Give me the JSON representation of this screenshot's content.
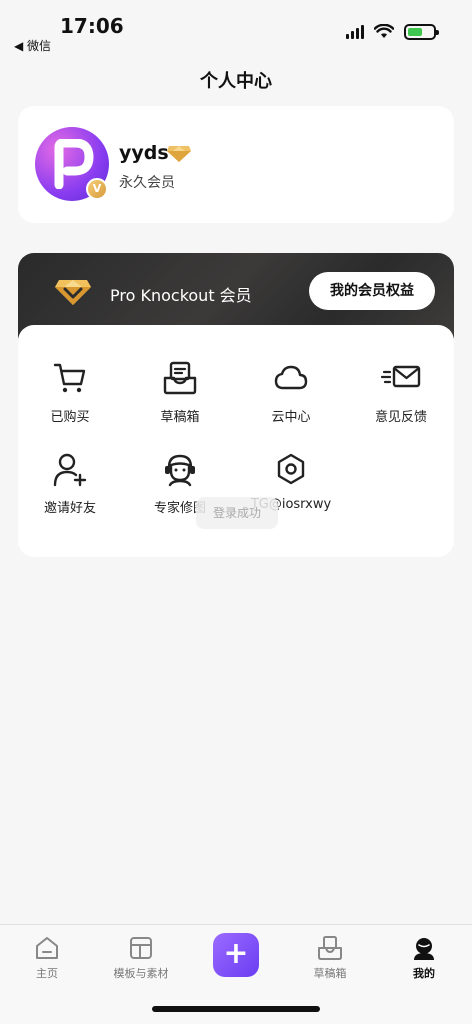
{
  "status_bar": {
    "time": "17:06",
    "back_app": "◀ 微信"
  },
  "page_title": "个人中心",
  "profile": {
    "username": "yyds",
    "member_type": "永久会员",
    "badge": "V"
  },
  "pro_banner": {
    "title": "Pro Knockout 会员",
    "button_label": "我的会员权益"
  },
  "grid": {
    "items": [
      {
        "label": "已购买",
        "icon": "cart-icon"
      },
      {
        "label": "草稿箱",
        "icon": "drafts-icon"
      },
      {
        "label": "云中心",
        "icon": "cloud-icon"
      },
      {
        "label": "意见反馈",
        "icon": "feedback-icon"
      },
      {
        "label": "邀请好友",
        "icon": "invite-friend-icon"
      },
      {
        "label": "专家修图",
        "icon": "expert-icon"
      },
      {
        "label": "TG@iosrxwy",
        "icon": "settings-hex-icon"
      }
    ]
  },
  "toast": "登录成功",
  "tab_bar": {
    "tabs": [
      {
        "label": "主页",
        "icon": "home-icon"
      },
      {
        "label": "模板与素材",
        "icon": "template-icon"
      },
      {
        "label": "",
        "icon": "plus-icon"
      },
      {
        "label": "草稿箱",
        "icon": "drafts-tab-icon"
      },
      {
        "label": "我的",
        "icon": "profile-icon"
      }
    ],
    "create_symbol": "+"
  },
  "colors": {
    "accent": "#7a4df5",
    "gold": "#e8b04a",
    "banner_dark": "#2c2c2d"
  }
}
